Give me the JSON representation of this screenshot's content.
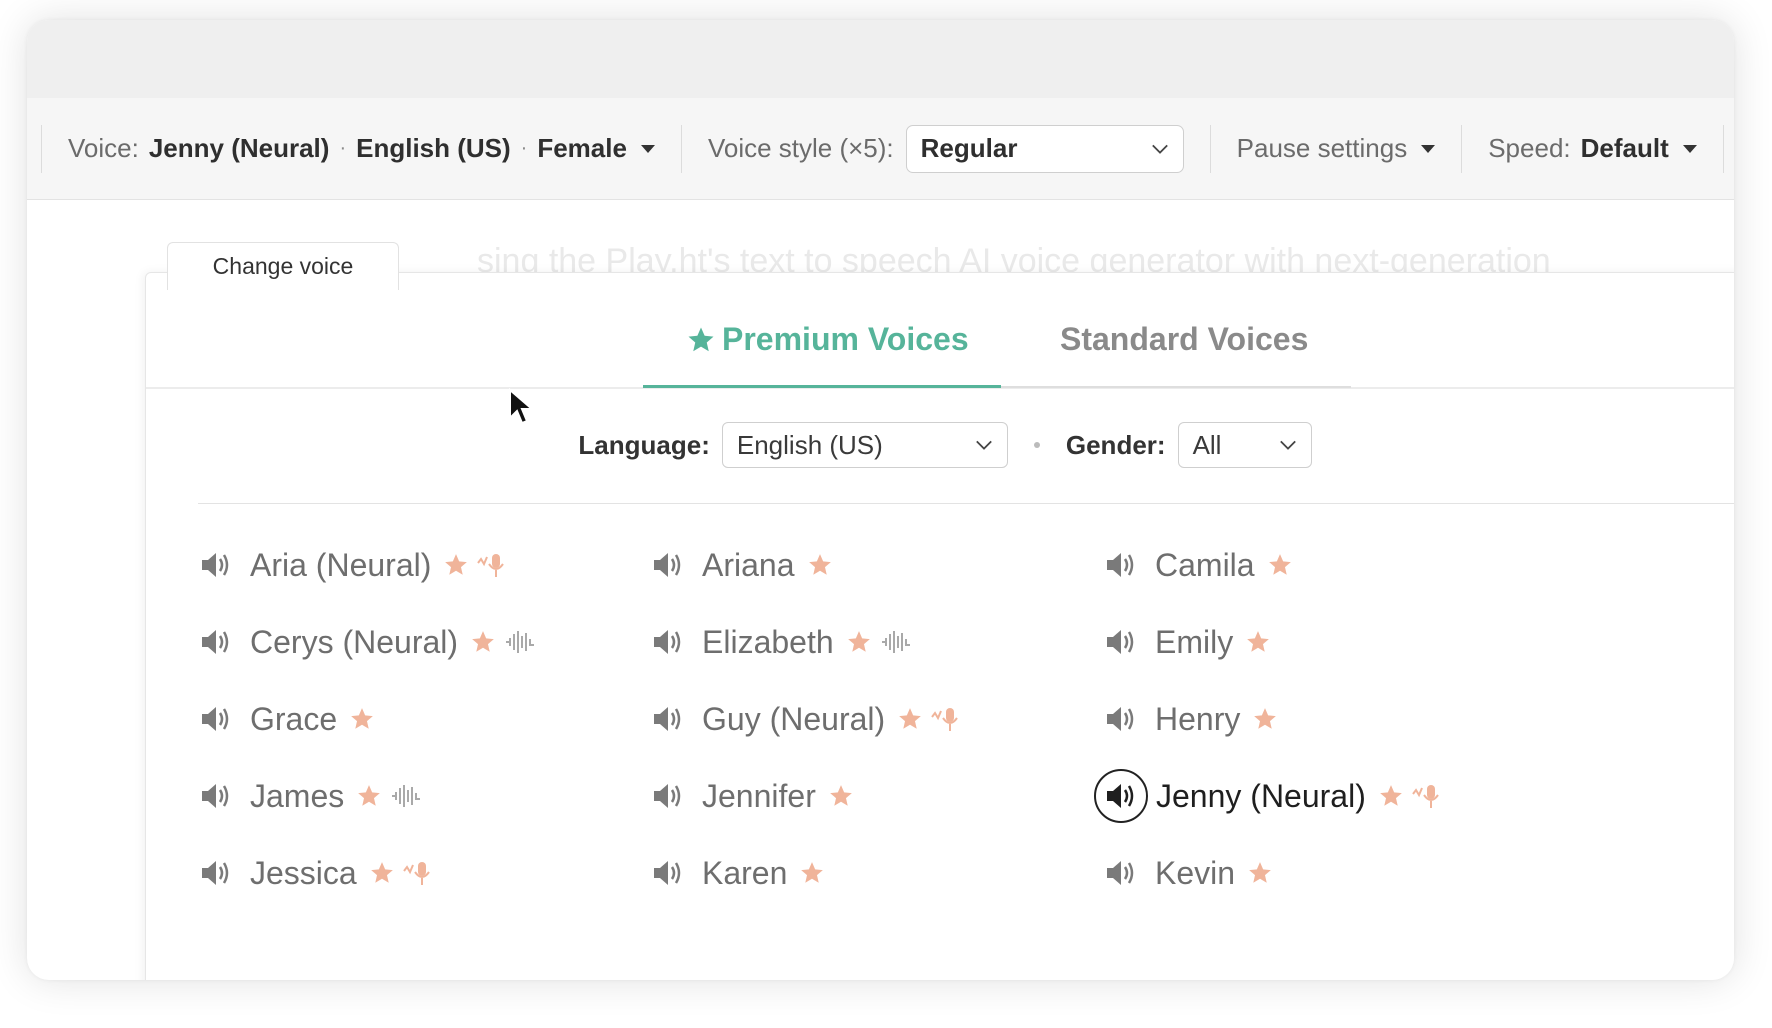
{
  "toolbar": {
    "voice_label": "Voice:",
    "voice_name": "Jenny (Neural)",
    "voice_language": "English (US)",
    "voice_gender": "Female",
    "dot": "·",
    "style_label": "Voice style (×5):",
    "style_value": "Regular",
    "pause_label": "Pause settings",
    "speed_label": "Speed:",
    "speed_value": "Default"
  },
  "background_text": "sing the Play.ht's text to speech AI voice generator with next-generation",
  "change_voice_label": "Change voice",
  "tabs": [
    {
      "label": "Premium Voices",
      "active": true
    },
    {
      "label": "Standard Voices",
      "active": false
    }
  ],
  "filters": {
    "language_label": "Language:",
    "language_value": "English (US)",
    "gender_label": "Gender:",
    "gender_value": "All"
  },
  "voices": [
    {
      "name": "Aria (Neural)",
      "badge": "mic-wave-icon",
      "selected": false
    },
    {
      "name": "Ariana",
      "badge": "",
      "selected": false
    },
    {
      "name": "Camila",
      "badge": "",
      "selected": false
    },
    {
      "name": "Cerys (Neural)",
      "badge": "waveform-icon",
      "selected": false
    },
    {
      "name": "Elizabeth",
      "badge": "waveform-icon",
      "selected": false
    },
    {
      "name": "Emily",
      "badge": "",
      "selected": false
    },
    {
      "name": "Grace",
      "badge": "",
      "selected": false
    },
    {
      "name": "Guy (Neural)",
      "badge": "mic-wave-icon",
      "selected": false
    },
    {
      "name": "Henry",
      "badge": "",
      "selected": false
    },
    {
      "name": "James",
      "badge": "waveform-icon",
      "selected": false
    },
    {
      "name": "Jennifer",
      "badge": "",
      "selected": false
    },
    {
      "name": "Jenny (Neural)",
      "badge": "mic-wave-icon",
      "selected": true
    },
    {
      "name": "Jessica",
      "badge": "mic-wave-icon",
      "selected": false
    },
    {
      "name": "Karen",
      "badge": "",
      "selected": false
    },
    {
      "name": "Kevin",
      "badge": "",
      "selected": false
    }
  ],
  "colors": {
    "accent": "#56b49a",
    "star": "#f0b49a",
    "badge": "#f0b49a"
  }
}
